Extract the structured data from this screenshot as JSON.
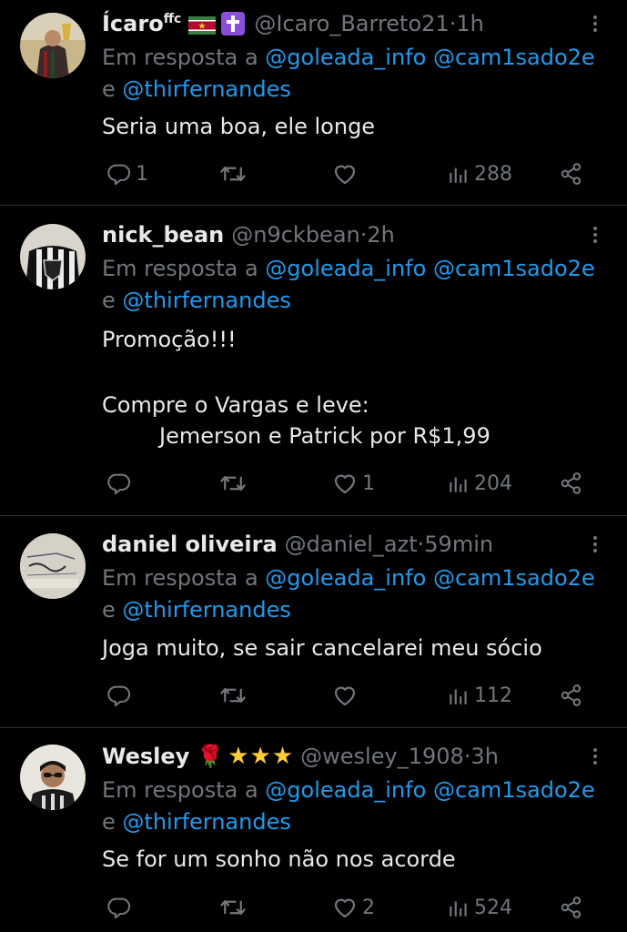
{
  "tweets": [
    {
      "name": "Ícaro",
      "name_sup": "ffc",
      "handle": "@Icaro_Barreto21",
      "time": "1h",
      "reply_prefix": "Em resposta a",
      "mention1": "@goleada_info",
      "mention2": "@cam1sado2e",
      "reply_join": "e",
      "mention3": "@thirfernandes",
      "text": "Seria uma boa, ele longe",
      "replies": "1",
      "retweets": "",
      "likes": "",
      "views": "288"
    },
    {
      "name": "nick_bean",
      "handle": "@n9ckbean",
      "time": "2h",
      "reply_prefix": "Em resposta a",
      "mention1": "@goleada_info",
      "mention2": "@cam1sado2e",
      "reply_join": "e",
      "mention3": "@thirfernandes",
      "text_line1": "Promoção!!!",
      "text_line2": "Compre o Vargas e leve:",
      "text_line3": "Jemerson e Patrick por R$1,99",
      "replies": "",
      "retweets": "",
      "likes": "1",
      "views": "204"
    },
    {
      "name": "daniel oliveira",
      "handle": "@daniel_azt",
      "time": "59min",
      "reply_prefix": "Em resposta a",
      "mention1": "@goleada_info",
      "mention2": "@cam1sado2e",
      "reply_join": "e",
      "mention3": "@thirfernandes",
      "text": "Joga muito, se sair cancelarei meu sócio",
      "replies": "",
      "retweets": "",
      "likes": "",
      "views": "112"
    },
    {
      "name": "Wesley",
      "handle": "@wesley_1908",
      "time": "3h",
      "reply_prefix": "Em resposta a",
      "mention1": "@goleada_info",
      "mention2": "@cam1sado2e",
      "reply_join": "e",
      "mention3": "@thirfernandes",
      "text": "Se for um sonho não nos acorde",
      "replies": "",
      "retweets": "",
      "likes": "2",
      "views": "524"
    }
  ],
  "separator": " · ",
  "icons": [
    "reply-icon",
    "retweet-icon",
    "like-icon",
    "views-icon",
    "share-icon",
    "more-icon"
  ],
  "colors": {
    "background": "#000000",
    "text": "#e7e9ea",
    "muted": "#71767b",
    "mention": "#1d9bf0",
    "divider": "#2f3336"
  }
}
